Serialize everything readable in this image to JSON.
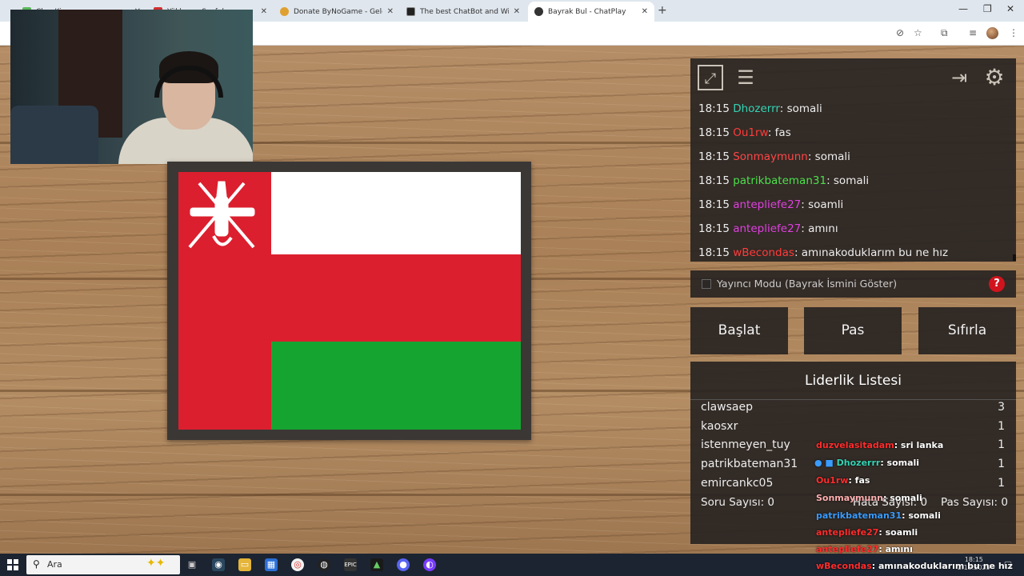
{
  "browser": {
    "tabs": [
      {
        "label": "Ch... Ki...",
        "x": 0,
        "active": false,
        "color": "#5cb85c"
      },
      {
        "label": "Yüklenen Sayfalar",
        "x": 0,
        "active": false,
        "color": "#d32f2f"
      },
      {
        "label": "Donate ByNoGame - Gelen/Gid",
        "active": false,
        "color": "#e0a030"
      },
      {
        "label": "The best ChatBot and Widgets",
        "active": false,
        "color": "#222222"
      },
      {
        "label": "Bayrak Bul - ChatPlay",
        "active": true,
        "color": "#333333"
      }
    ],
    "new_tab": "+",
    "win_min": "—",
    "win_max": "❐",
    "win_close": "✕"
  },
  "panel": {
    "chat": [
      {
        "time": "18:15",
        "user": "Dhozerrr",
        "color": "#34d3b4",
        "msg": ": somali"
      },
      {
        "time": "18:15",
        "user": "Ou1rw",
        "color": "#ff3b3b",
        "msg": ": fas"
      },
      {
        "time": "18:15",
        "user": "Sonmaymunn",
        "color": "#ff4646",
        "msg": ": somali"
      },
      {
        "time": "18:15",
        "user": "patrikbateman31",
        "color": "#4be04b",
        "msg": ": somali"
      },
      {
        "time": "18:15",
        "user": "antepliefe27",
        "color": "#e040e0",
        "msg": ": soamli"
      },
      {
        "time": "18:15",
        "user": "antepliefe27",
        "color": "#e040e0",
        "msg": ": amını"
      },
      {
        "time": "18:15",
        "user": "wBecondas",
        "color": "#ff3b3b",
        "msg": ": amınakoduklarım bu ne hız"
      }
    ],
    "streamer_mode_label": "Yayıncı Modu (Bayrak İsmini Göster)",
    "help_label": "?",
    "buttons": {
      "start": "Başlat",
      "pass": "Pas",
      "reset": "Sıfırla"
    },
    "leaderboard": {
      "title": "Liderlik Listesi",
      "rows": [
        {
          "name": "clawsaep",
          "score": "3"
        },
        {
          "name": "kaosxr",
          "score": "1"
        },
        {
          "name": "istenmeyen_tuy",
          "score": "1"
        },
        {
          "name": "patrikbateman31",
          "score": "1"
        },
        {
          "name": "emircankc05",
          "score": "1"
        }
      ],
      "stats": {
        "questions": "Soru Sayısı: 0",
        "errors": "Hata Sayısı: 0",
        "passes": "Pas Sayısı: 0"
      }
    }
  },
  "overlay_chat": [
    {
      "user": "duzvelasitadam",
      "msg": ": sri lanka",
      "color": "#ff2d2d"
    },
    {
      "user": "Dhozerrr",
      "msg": ": somali",
      "color": "#34d3b4"
    },
    {
      "user": "Ou1rw",
      "msg": ": fas",
      "color": "#ff2d2d"
    },
    {
      "user": "Sonmaymunn",
      "msg": ": somali",
      "color": "#ff6a6a"
    },
    {
      "user": "patrikbateman31",
      "msg": ": somali",
      "color": "#3a9cff"
    },
    {
      "user": "antepliefe27",
      "msg": ": soamli",
      "color": "#ff2d2d"
    },
    {
      "user": "antepliefe27",
      "msg": ": amını",
      "color": "#ff2d2d"
    },
    {
      "user": "wBecondas",
      "msg": ": amınakoduklarım bu ne hız",
      "color": "#ff2d2d"
    }
  ],
  "taskbar": {
    "search_placeholder": "Ara",
    "time": "18:15",
    "date": "2.12.2025"
  }
}
